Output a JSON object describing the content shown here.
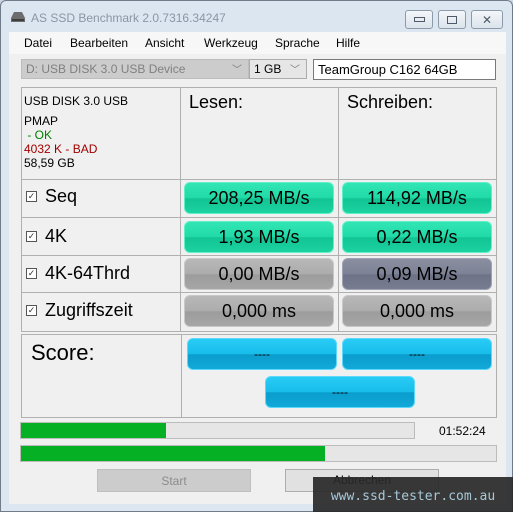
{
  "window": {
    "title": "AS SSD Benchmark 2.0.7316.34247",
    "controls": {
      "minimize": "minimize",
      "maximize": "maximize",
      "close": "close"
    }
  },
  "menu": [
    "Datei",
    "Bearbeiten",
    "Ansicht",
    "Werkzeug",
    "Sprache",
    "Hilfe"
  ],
  "toolbar": {
    "device": "D: USB DISK 3.0 USB Device",
    "size": "1 GB",
    "drive_name": "TeamGroup C162 64GB"
  },
  "info": {
    "model": "USB DISK 3.0 USB",
    "driver": "PMAP",
    "driver_status": " - OK",
    "alignment": "4032 K - BAD",
    "capacity": "58,59 GB",
    "colors": {
      "ok": "#008000",
      "bad": "#a00000"
    }
  },
  "headers": {
    "read": "Lesen:",
    "write": "Schreiben:"
  },
  "rows": [
    {
      "label": "Seq",
      "checked": true,
      "read": "208,25 MB/s",
      "write": "114,92 MB/s"
    },
    {
      "label": "4K",
      "checked": true,
      "read": "1,93 MB/s",
      "write": "0,22 MB/s"
    },
    {
      "label": "4K-64Thrd",
      "checked": true,
      "read": "0,00 MB/s",
      "write": "0,09 MB/s"
    },
    {
      "label": "Zugriffszeit",
      "checked": true,
      "read": "0,000 ms",
      "write": "0,000 ms"
    }
  ],
  "score": {
    "label": "Score:",
    "read": "----",
    "write": "----",
    "total": "----"
  },
  "progress": {
    "test_progress_percent": 37,
    "total_progress_percent": 64,
    "elapsed": "01:52:24",
    "color": "#06b025"
  },
  "buttons": {
    "start": "Start",
    "abort": "Abbrechen"
  },
  "watermark": "www.ssd-tester.com.au"
}
